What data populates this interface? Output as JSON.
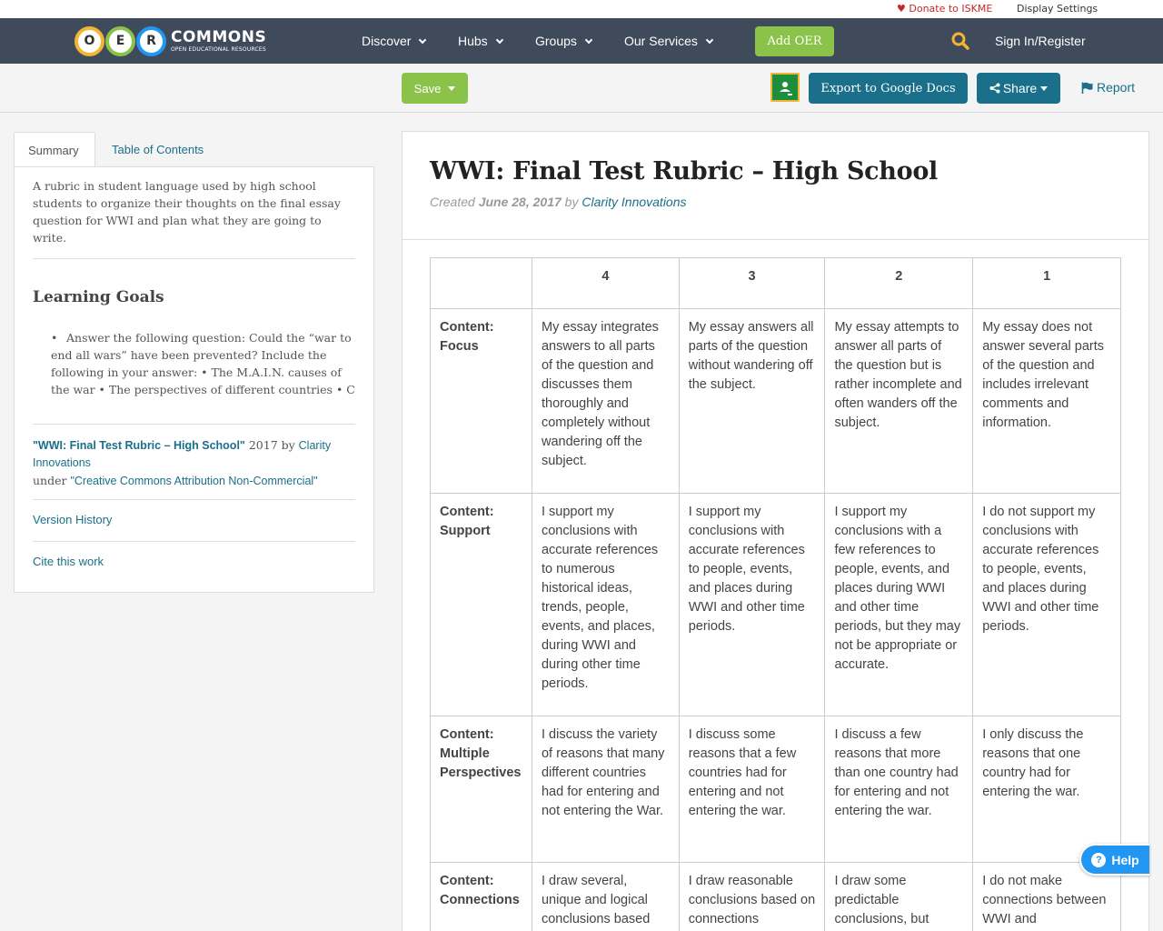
{
  "utility": {
    "donate_label": "Donate to ISKME",
    "display_settings_label": "Display Settings"
  },
  "navbar": {
    "logo": {
      "o": "O",
      "e": "E",
      "r": "R",
      "word": "COMMONS",
      "tagline": "OPEN EDUCATIONAL RESOURCES"
    },
    "items": [
      {
        "label": "Discover"
      },
      {
        "label": "Hubs"
      },
      {
        "label": "Groups"
      },
      {
        "label": "Our Services"
      }
    ],
    "add_oer_label": "Add OER",
    "signin_label": "Sign In/Register"
  },
  "actionbar": {
    "save_label": "Save",
    "export_label": "Export to Google Docs",
    "share_label": "Share",
    "report_label": "Report"
  },
  "sidebar": {
    "tabs": [
      {
        "label": "Summary"
      },
      {
        "label": "Table of Contents"
      }
    ],
    "summary": "A rubric in student language used by high school students to organize their thoughts on the final essay question for WWI and plan what they are going to write.",
    "goals_title": "Learning Goals",
    "goals": [
      "Answer the following question: Could the “war to end all wars” have been prevented? Include the following in your answer: • The M.A.I.N. causes of the war • The perspectives of different countries • C"
    ],
    "attribution": {
      "title": "\"WWI: Final Test Rubric – High School\"",
      "year": " 2017 by ",
      "author": "Clarity Innovations",
      "under": "under ",
      "license": "\"Creative Commons Attribution Non-Commercial\""
    },
    "version_history_label": "Version History",
    "cite_label": "Cite this work"
  },
  "main": {
    "title": "WWI: Final Test Rubric – High School",
    "created_prefix": "Created ",
    "created_date": "June 28, 2017",
    "by_text": " by ",
    "author": "Clarity Innovations"
  },
  "rubric": {
    "headers": [
      "",
      "4",
      "3",
      "2",
      "1"
    ],
    "rows": [
      {
        "criterion": "Content: Focus",
        "cells": [
          "My essay integrates answers to all parts of the question and discusses them thoroughly and completely without wandering off the subject.",
          "My essay answers all parts of the question without wandering off the subject.",
          "My essay attempts to answer all parts of the question but is rather incomplete and often wanders off the subject.",
          "My essay does not answer several parts of the question and includes irrelevant comments and information."
        ]
      },
      {
        "criterion": "Content: Support",
        "cells": [
          "I support my conclusions with accurate references to numerous historical ideas, trends, people, events, and places, during WWI and during other time periods.",
          "I support my conclusions with accurate references to people, events, and places during WWI and other time periods.",
          "I support my conclusions with a few references to people, events, and places during WWI and other time periods, but they may not be appropriate or accurate.",
          "I do not support my conclusions with accurate references to people, events, and places during WWI and other time periods."
        ]
      },
      {
        "criterion": "Content: Multiple Perspectives",
        "cells": [
          "I discuss the variety of reasons that many different countries had for entering and not entering the War.",
          "I discuss some reasons that a few countries had for entering and not entering the war.",
          "I discuss a few reasons that more than one country had for entering and not entering the war.",
          "I only discuss the reasons that one country had for entering the war."
        ]
      },
      {
        "criterion": "Content: Connections",
        "cells": [
          "I draw several, unique and logical conclusions based",
          "I draw reasonable conclusions based on connections",
          "I draw some predictable conclusions, but",
          "I do not make connections between WWI and"
        ]
      }
    ]
  },
  "help_label": "Help",
  "colors": {
    "navbar": "#3f4a5a",
    "accent_green": "#8bc34a",
    "teal": "#1a6f8a",
    "help_blue": "#2196f3"
  }
}
